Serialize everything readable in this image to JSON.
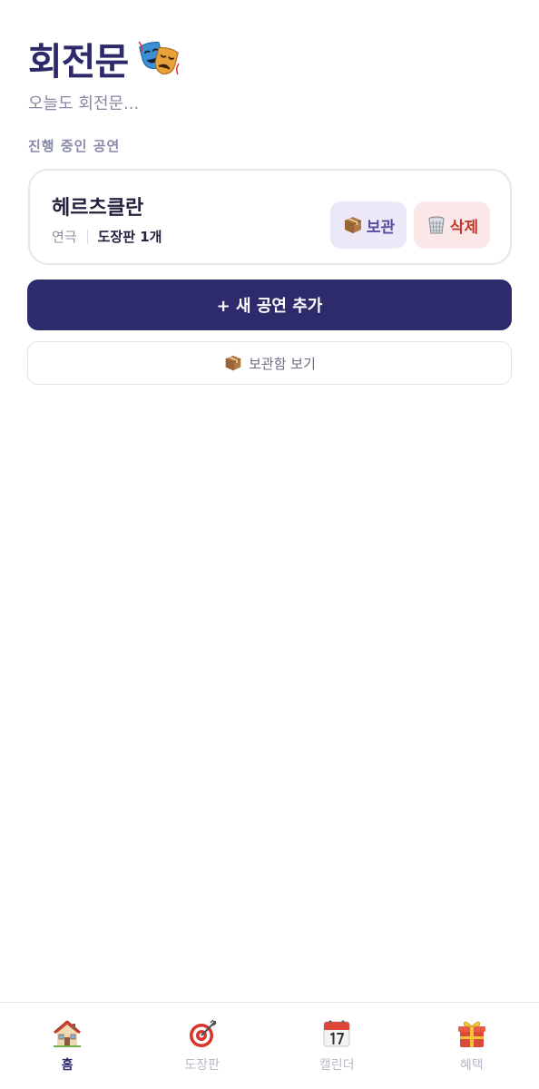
{
  "header": {
    "title": "회전문",
    "title_icon": "theater-masks-icon",
    "subtitle": "오늘도 회전문..."
  },
  "section": {
    "label": "진행 중인 공연"
  },
  "shows": [
    {
      "name": "헤르츠클란",
      "genre": "연극",
      "stamps": "도장판 1개",
      "archive_label": "보관",
      "archive_icon": "package-icon",
      "delete_label": "삭제",
      "delete_icon": "wastebasket-icon"
    }
  ],
  "actions": {
    "add_label": "+ 새 공연 추가",
    "archive_view_label": "보관함 보기",
    "archive_view_icon": "package-icon"
  },
  "tabs": [
    {
      "label": "홈",
      "icon": "house-icon",
      "active": true
    },
    {
      "label": "도장판",
      "icon": "target-icon",
      "active": false
    },
    {
      "label": "캘린더",
      "icon": "calendar-icon",
      "active": false
    },
    {
      "label": "혜택",
      "icon": "gift-icon",
      "active": false
    }
  ],
  "colors": {
    "primary": "#2e2b6d",
    "archive_bg": "#ece8f8",
    "archive_text": "#5a4aa0",
    "delete_bg": "#fbe7e7",
    "delete_text": "#c0392b"
  }
}
